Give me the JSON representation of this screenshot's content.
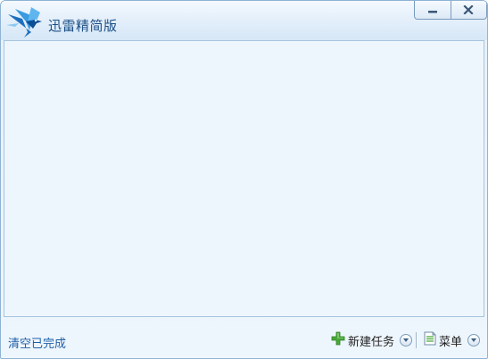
{
  "window": {
    "title": "迅雷精简版",
    "controls": {
      "minimize_icon": "minimize-icon",
      "close_icon": "close-icon"
    }
  },
  "footer": {
    "clear_completed": "清空已完成",
    "new_task": "新建任务",
    "menu": "菜单"
  },
  "colors": {
    "accent": "#1f5fa8",
    "frame": "#8fb3d4",
    "content_bg": "#eef6fd",
    "new_task_plus": "#4aa83a"
  }
}
